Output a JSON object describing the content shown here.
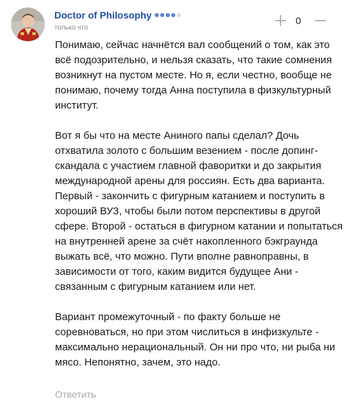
{
  "comment": {
    "author": "Doctor of Philosophy",
    "rating_dots": [
      "#5b86d8",
      "#5b86d8",
      "#5b86d8",
      "#5b86d8",
      "#d5dbe6"
    ],
    "time": "только что",
    "votes": "0",
    "paragraphs": [
      "Понимаю, сейчас начнётся вал сообщений о том, как это всё подозрительно, и нельзя сказать, что такие сомнения возникнут на пустом месте. Но я, если честно, вообще не понимаю, почему тогда Анна поступила в физкультурный институт.",
      "Вот я бы что на месте Аниного папы сделал? Дочь отхватила золото с большим везением - после допинг-скандала с участием главной фаворитки и до закрытия международной арены для россиян. Есть два варианта. Первый - закончить с фигурным катанием и поступить в хороший ВУЗ, чтобы были потом перспективы в другой сфере. Второй - остаться в фигурном катании и попытаться на внутренней арене за счёт накопленного бэкграунда выжать всё, что можно. Пути вполне равноправны, в зависимости от того, каким видится будущее Ани - связанным с фигурным катанием или нет.",
      "Вариант промежуточный - по факту больше не соревноваться, но при этом числиться в инфизкульте - максимально нерациональный. Он ни про что, ни рыба ни мясо. Непонятно, зачем, это надо."
    ],
    "reply_label": "Ответить"
  },
  "colors": {
    "author_link": "#1f4f9e",
    "muted_text": "#8a8a8a",
    "reply_text": "#a8a8a8",
    "icon_gray": "#b5b5b5"
  },
  "icons": {
    "upvote": "plus-icon",
    "downvote": "minus-icon"
  }
}
